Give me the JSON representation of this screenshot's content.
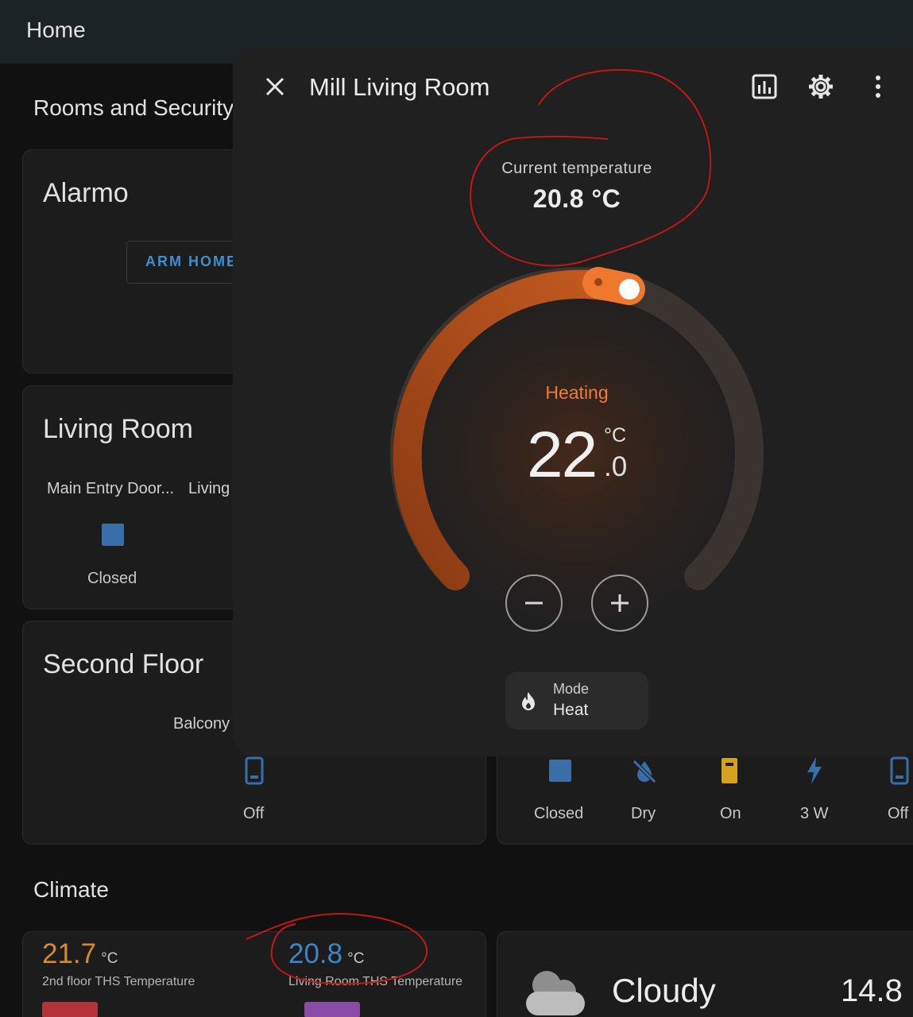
{
  "header": {
    "title": "Home"
  },
  "sections": {
    "rooms": "Rooms and Security",
    "climate": "Climate"
  },
  "alarmo": {
    "title": "Alarmo",
    "arm_home": "ARM HOME"
  },
  "living_room": {
    "title": "Living Room",
    "entity1_name": "Main Entry Door...",
    "entity1_state": "Closed",
    "entity2_name": "Living"
  },
  "second_floor": {
    "title": "Second Floor",
    "balcony": "Balcony",
    "off_state": "Off"
  },
  "right_row": [
    {
      "state": "Closed",
      "icon": "square-icon"
    },
    {
      "state": "Dry",
      "icon": "water-off-icon"
    },
    {
      "state": "On",
      "icon": "battery-icon"
    },
    {
      "state": "3 W",
      "icon": "flash-icon"
    },
    {
      "state": "Off",
      "icon": "phone-icon"
    }
  ],
  "dialog": {
    "title": "Mill Living Room",
    "current_label": "Current temperature",
    "current_value": "20.8 °C",
    "action": "Heating",
    "target_integer": "22",
    "target_unit": "°C",
    "target_decimal": ".0",
    "target_value": 22.0,
    "mode_label": "Mode",
    "mode_value": "Heat",
    "colors": {
      "heat": "#ef7b3a",
      "arc_inactive": "#3a3330"
    }
  },
  "climate": [
    {
      "value": "21.7",
      "unit": "°C",
      "name": "2nd floor THS Temperature",
      "color": "#d58a2e"
    },
    {
      "value": "20.8",
      "unit": "°C",
      "name": "Living Room THS Temperature",
      "color": "#3d86c6"
    }
  ],
  "weather": {
    "condition": "Cloudy",
    "temperature": "14.8"
  }
}
